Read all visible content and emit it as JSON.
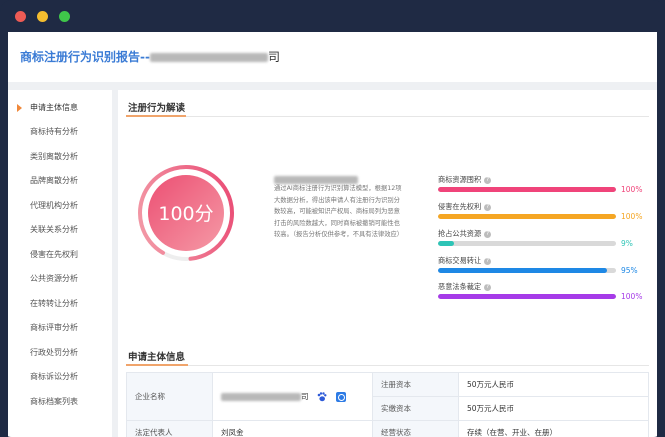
{
  "report": {
    "title_prefix": "商标注册行为识别报告--",
    "title_suffix": "司"
  },
  "sidebar": {
    "items": [
      {
        "label": "申请主体信息",
        "active": true
      },
      {
        "label": "商标持有分析"
      },
      {
        "label": "类别离散分析"
      },
      {
        "label": "品牌离散分析"
      },
      {
        "label": "代理机构分析"
      },
      {
        "label": "关联关系分析"
      },
      {
        "label": "侵害在先权利"
      },
      {
        "label": "公共资源分析"
      },
      {
        "label": "在转转让分析"
      },
      {
        "label": "商标评审分析"
      },
      {
        "label": "行政处罚分析"
      },
      {
        "label": "商标诉讼分析"
      },
      {
        "label": "商标档案列表"
      }
    ]
  },
  "behavior": {
    "section_title": "注册行为解读",
    "score": "100分",
    "description": "通过AI商标注册行为识别算法模型，根据12项大数据分析，得出该申请人有注册行为识别分数较高，可能被知识产权局、商标局列为恶意打击的风险数越大，同时商标被撤销可能性也较高。（报告分析仅供参考，不具有法律效应）",
    "metrics": [
      {
        "label": "商标资源囤积",
        "percent": 100,
        "display": "100%",
        "color": "#f0447a"
      },
      {
        "label": "侵害在先权利",
        "percent": 100,
        "display": "100%",
        "color": "#f5a623"
      },
      {
        "label": "抢占公共资源",
        "percent": 9,
        "display": "9%",
        "color": "#2ec4b6"
      },
      {
        "label": "商标交易转让",
        "percent": 95,
        "display": "95%",
        "color": "#1e88e5"
      },
      {
        "label": "恶意法条裁定",
        "percent": 100,
        "display": "100%",
        "color": "#a63be8"
      }
    ]
  },
  "applicant": {
    "section_title": "申请主体信息",
    "company_label": "企业名称",
    "company_suffix": "司",
    "legal_rep_label": "法定代表人",
    "legal_rep_value": "刘凤金",
    "registered_capital_label": "注册资本",
    "registered_capital_value": "50万元人民币",
    "paid_capital_label": "实缴资本",
    "paid_capital_value": "50万元人民币",
    "status_label": "经营状态",
    "status_value": "存续（在营、开业、在册）"
  },
  "colors": {
    "accent_blue": "#3a7bd5",
    "gauge_start": "#ee5a7a",
    "gauge_end": "#f3a0a8",
    "section_underline": "#f0a46b"
  }
}
